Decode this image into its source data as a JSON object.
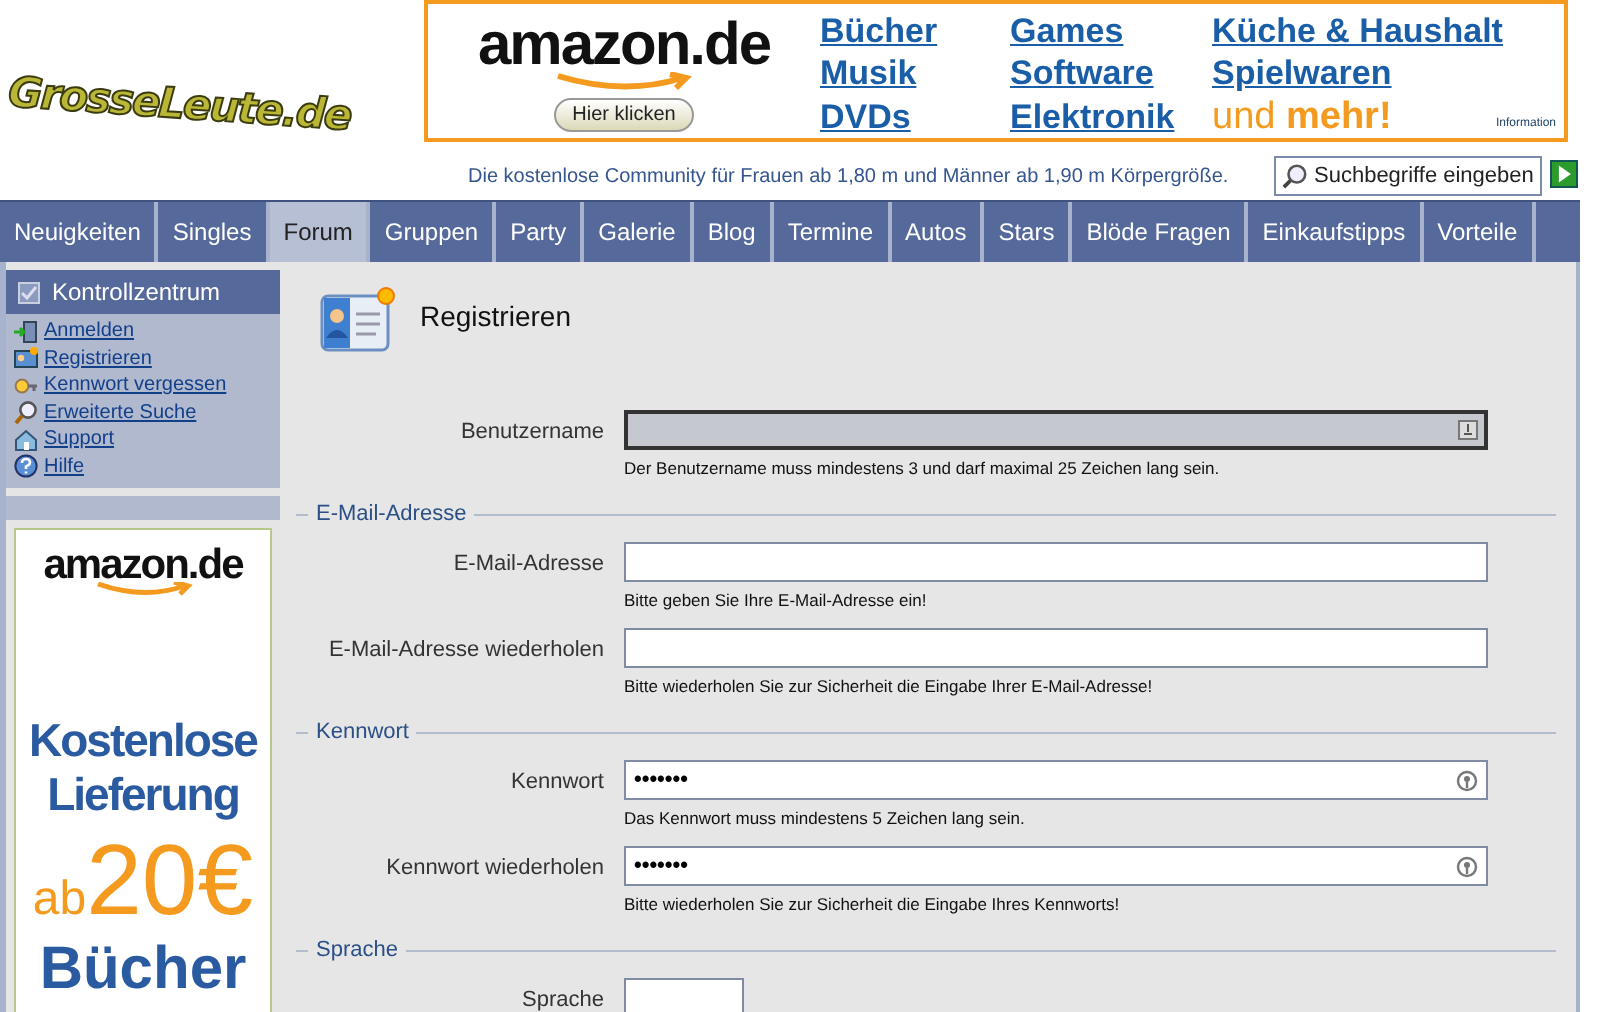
{
  "logo": {
    "text": "GrosseLeute.de"
  },
  "banner": {
    "brand": "amazon.de",
    "button": "Hier klicken",
    "categories": [
      "Bücher",
      "Games",
      "Küche & Haushalt",
      "Musik",
      "Software",
      "Spielwaren",
      "DVDs",
      "Elektronik"
    ],
    "more": "und **mehr!**",
    "info": "Information"
  },
  "tagline": "Die kostenlose Community für Frauen ab 1,80 m und Männer ab 1,90 m Körpergröße.",
  "search": {
    "placeholder": "Suchbegriffe eingeben"
  },
  "nav": [
    {
      "label": "Neuigkeiten",
      "selected": false
    },
    {
      "label": "Singles",
      "selected": false
    },
    {
      "label": "Forum",
      "selected": true
    },
    {
      "label": "Gruppen",
      "selected": false
    },
    {
      "label": "Party",
      "selected": false
    },
    {
      "label": "Galerie",
      "selected": false
    },
    {
      "label": "Blog",
      "selected": false
    },
    {
      "label": "Termine",
      "selected": false
    },
    {
      "label": "Autos",
      "selected": false
    },
    {
      "label": "Stars",
      "selected": false
    },
    {
      "label": "Blöde Fragen",
      "selected": false
    },
    {
      "label": "Einkaufstipps",
      "selected": false
    },
    {
      "label": "Vorteile",
      "selected": false
    }
  ],
  "sidebar": {
    "title": "Kontrollzentrum",
    "items": [
      {
        "label": "Anmelden",
        "kind": "door"
      },
      {
        "label": "Registrieren",
        "kind": "card"
      },
      {
        "label": "Kennwort vergessen",
        "kind": "key"
      },
      {
        "label": "Erweiterte Suche",
        "kind": "search"
      },
      {
        "label": "Support",
        "kind": "house"
      },
      {
        "label": "Hilfe",
        "kind": "help"
      }
    ],
    "ad": {
      "brand": "amazon.de",
      "headline": "Kostenlose Lieferung",
      "prefix": "ab",
      "amount": "20€",
      "product": "Bücher"
    }
  },
  "form": {
    "title": "Registrieren",
    "sections": [
      {
        "fields": [
          {
            "label": "Benutzername",
            "kind": "text",
            "focused": true,
            "hint": "Der Benutzername muss mindestens 3 und darf maximal 25 Zeichen lang sein."
          }
        ]
      },
      {
        "legend": "E-Mail-Adresse",
        "fields": [
          {
            "label": "E-Mail-Adresse",
            "kind": "text",
            "focused": false,
            "hint": "Bitte geben Sie Ihre E-Mail-Adresse ein!"
          },
          {
            "label": "E-Mail-Adresse wiederholen",
            "kind": "text",
            "focused": false,
            "hint": "Bitte wiederholen Sie zur Sicherheit die Eingabe Ihrer E-Mail-Adresse!"
          }
        ]
      },
      {
        "legend": "Kennwort",
        "fields": [
          {
            "label": "Kennwort",
            "kind": "password",
            "focused": false,
            "value": "•••••••",
            "hint": "Das Kennwort muss mindestens 5 Zeichen lang sein."
          },
          {
            "label": "Kennwort wiederholen",
            "kind": "password",
            "focused": false,
            "value": "•••••••",
            "hint": "Bitte wiederholen Sie zur Sicherheit die Eingabe Ihres Kennworts!"
          }
        ]
      },
      {
        "legend": "Sprache",
        "fields": [
          {
            "label": "Sprache",
            "kind": "select",
            "focused": false
          }
        ]
      }
    ]
  }
}
